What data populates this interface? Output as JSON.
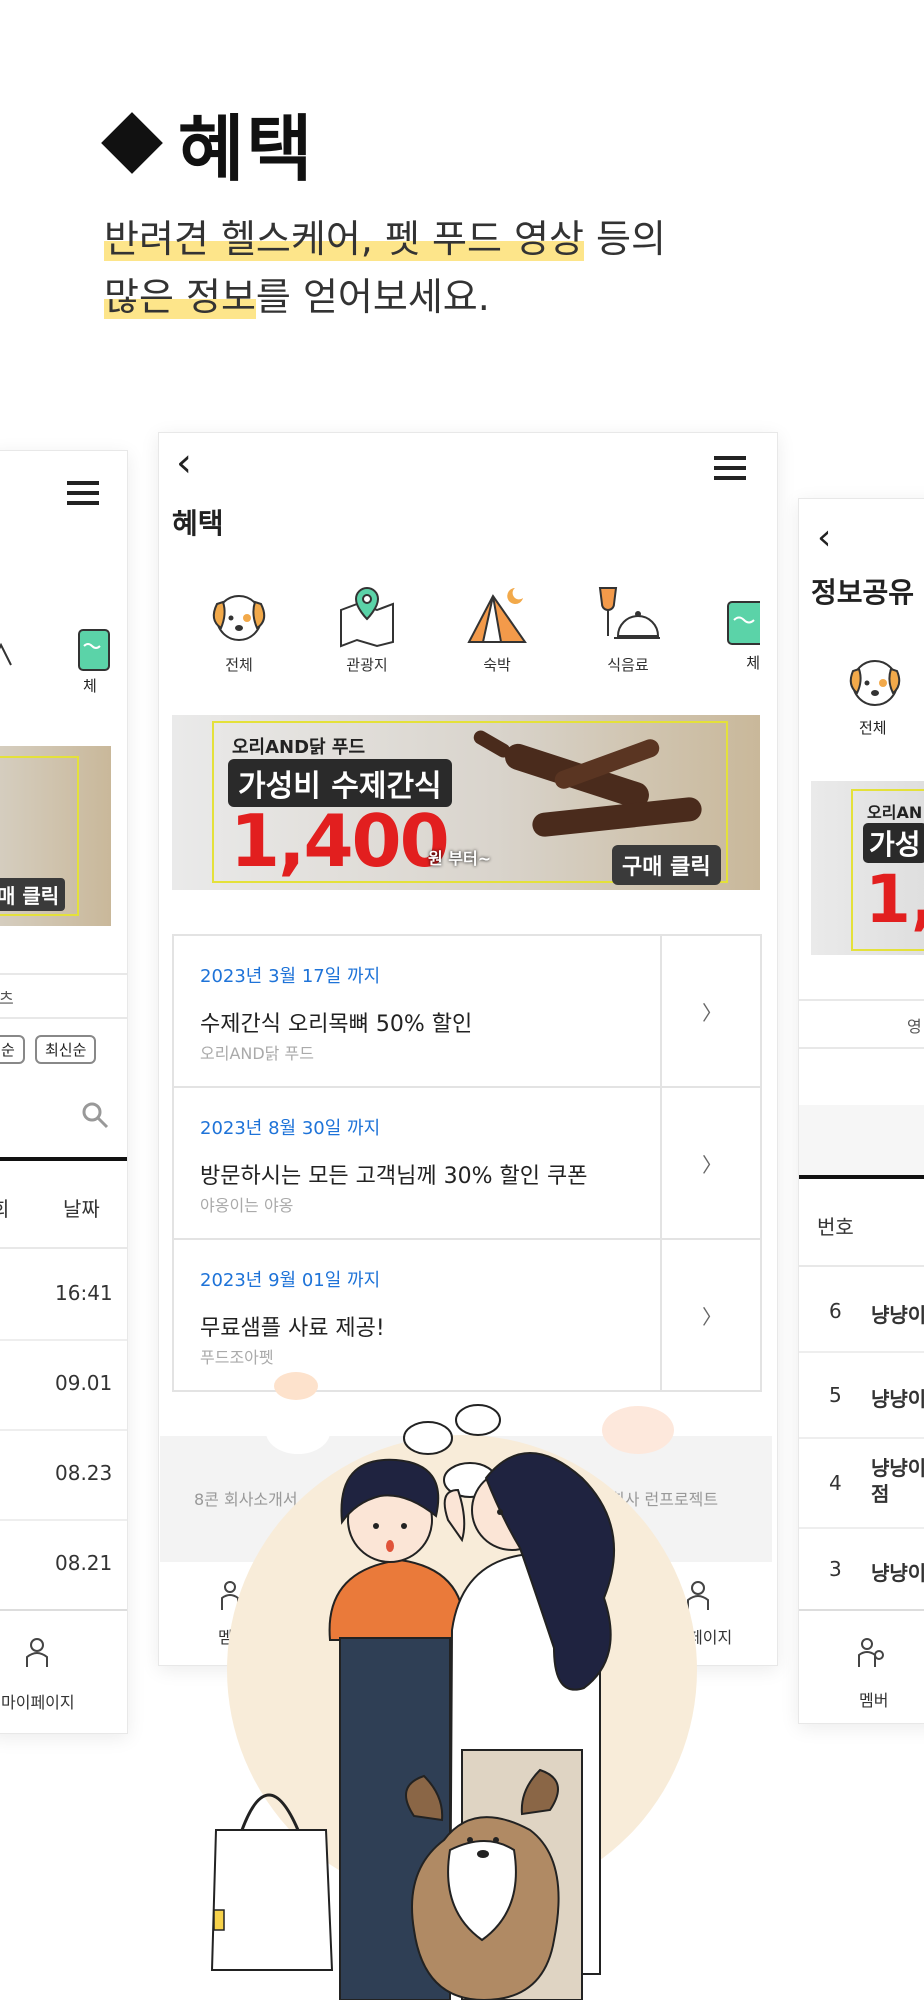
{
  "header": {
    "title": "혜택",
    "subtitle_line1_highlight": "반려견 헬스케어, 펫 푸드 영상",
    "subtitle_line1_rest": " 등의",
    "subtitle_line2_highlight": "많은 정보",
    "subtitle_line2_rest": "를 얻어보세요."
  },
  "center_phone": {
    "page_title": "혜택",
    "categories": [
      {
        "label": "전체",
        "icon": "dog-face-icon"
      },
      {
        "label": "관광지",
        "icon": "map-pin-icon"
      },
      {
        "label": "숙박",
        "icon": "tent-icon"
      },
      {
        "label": "식음료",
        "icon": "dining-icon"
      },
      {
        "label": "체",
        "icon": "water-cup-icon"
      }
    ],
    "banner": {
      "brand": "오리AND닭 푸드",
      "title": "가성비 수제간식",
      "price": "1,400",
      "unit": "원 부터~",
      "cta": "구매 클릭"
    },
    "benefits": [
      {
        "date": "2023년 3월 17일 까지",
        "title": "수제간식 오리목뼈 50% 할인",
        "brand": "오리AND닭 푸드"
      },
      {
        "date": "2023년 8월 30일 까지",
        "title": "방문하시는 모든 고객님께 30% 할인 쿠폰",
        "brand": "야옹이는 야옹"
      },
      {
        "date": "2023년 9월 01일 까지",
        "title": "무료샘플 사료 제공!",
        "brand": "푸드조아펫"
      }
    ],
    "arrow": "〉",
    "footer_left": "8콘 회사소개서",
    "footer_right": "회사 런프로젝트",
    "nav": {
      "left": "멤",
      "right": "페이지"
    }
  },
  "left_phone": {
    "category_partial": "체",
    "banner_cta": "매 클릭",
    "tab_partial": "츠",
    "sort_prev": "순",
    "sort_latest": "최신순",
    "col_views": "회",
    "col_date": "날짜",
    "dates": [
      "16:41",
      "09.01",
      "08.23",
      "08.21"
    ],
    "nav_mypage": "마이페이지"
  },
  "right_phone": {
    "page_title": "정보공유",
    "category": "전체",
    "banner_brand": "오리AN",
    "banner_title": "가성",
    "banner_price": "1,",
    "tab_partial": "영",
    "col_no": "번호",
    "rows": [
      {
        "no": "6",
        "title": "냥냥이"
      },
      {
        "no": "5",
        "title": "냥냥이"
      },
      {
        "no": "4",
        "title": "냥냥이 점"
      },
      {
        "no": "3",
        "title": "냥냥이"
      }
    ],
    "nav_member": "멤버"
  },
  "colors": {
    "highlight": "#fde58a",
    "accent_blue": "#1e73d8",
    "price_red": "#e21f1f",
    "illustration_bg": "#f8ecd9"
  }
}
